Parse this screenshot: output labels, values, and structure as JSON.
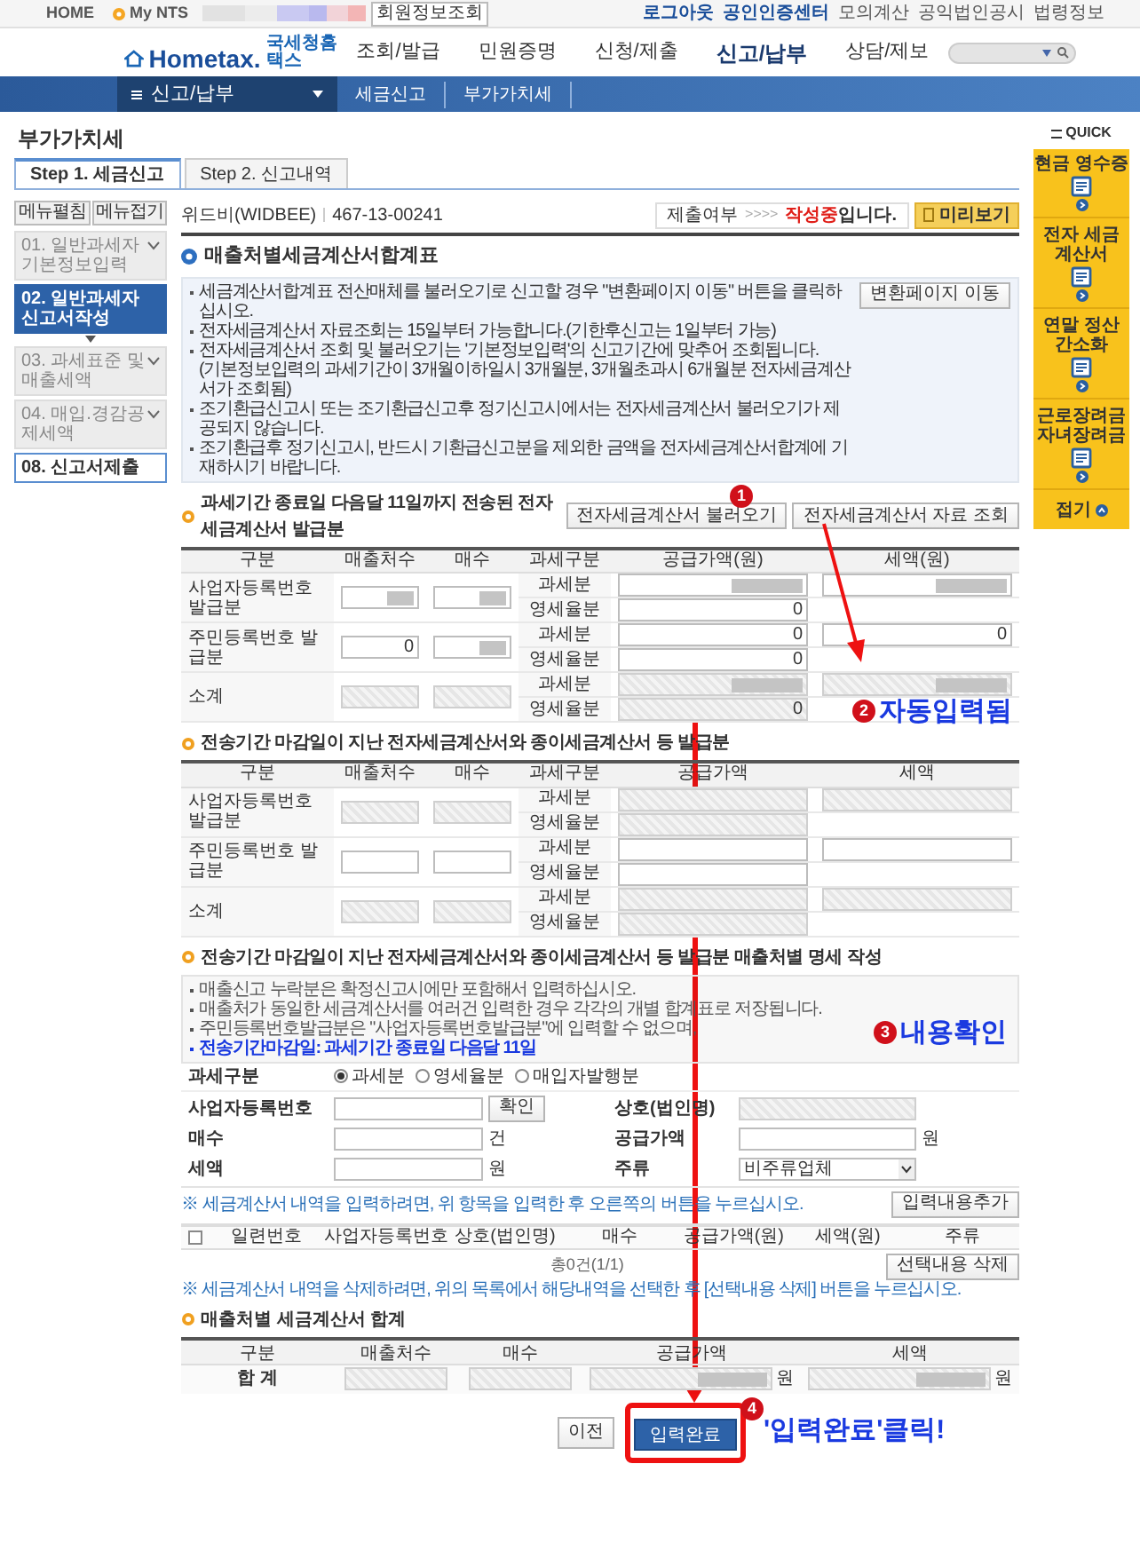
{
  "top_bar": {
    "links_left": [
      "HOME",
      "My NTS"
    ],
    "member_button": "회원정보조회",
    "links_right": [
      "로그아웃",
      "공인인증센터",
      "모의계산",
      "공익법인공시",
      "법령정보"
    ]
  },
  "logo": {
    "name": "Hometax.",
    "korean": "국세청홈택스"
  },
  "main_nav": [
    {
      "label": "조회/발급",
      "selected": false
    },
    {
      "label": "민원증명",
      "selected": false
    },
    {
      "label": "신청/제출",
      "selected": false
    },
    {
      "label": "신고/납부",
      "selected": true
    },
    {
      "label": "상담/제보",
      "selected": false
    }
  ],
  "breadcrumb": {
    "menu": "신고/납부",
    "items": [
      "세금신고",
      "부가가치세"
    ]
  },
  "page_title": "부가가치세",
  "quick": {
    "title": "QUICK",
    "items": [
      "현금 영수증",
      "전자 세금 계산서",
      "연말 정산 간소화",
      "근로장려금 자녀장려금"
    ],
    "fold": "접기"
  },
  "step_tabs": [
    {
      "label": "Step 1. 세금신고",
      "selected": true
    },
    {
      "label": "Step 2. 신고내역",
      "selected": false
    }
  ],
  "side_menu": {
    "buttons": [
      "메뉴펼침",
      "메뉴접기"
    ],
    "items": [
      {
        "label": "01. 일반과세자 기본정보입력",
        "selected": false,
        "expandable": true
      },
      {
        "label": "02. 일반과세자 신고서작성",
        "selected": true,
        "expandable": false
      },
      {
        "label": "03. 과세표준 및 매출세액",
        "selected": false,
        "expandable": true
      },
      {
        "label": "04. 매입.경감공제세액",
        "selected": false,
        "expandable": true
      },
      {
        "label": "08. 신고서제출",
        "selected": false,
        "expandable": false
      }
    ]
  },
  "taxpayer": {
    "name": "위드비(WIDBEE)",
    "biz_no": "467-13-00241"
  },
  "status": {
    "label": "제출여부",
    "arrows": ">>>>",
    "value": "작성중",
    "suffix": "입니다.",
    "preview_button": "미리보기"
  },
  "form_title": "매출처별세금계산서합계표",
  "notice": {
    "button": "변환페이지 이동",
    "lines": [
      {
        "text": "세금계산서합계표 전산매체를 불러오기로 신고할 경우 \"변환페이지 이동\" 버튼을 클릭하십시오.",
        "bullet": true
      },
      {
        "text": "전자세금계산서 자료조회는 15일부터 가능합니다.(기한후신고는 1일부터 가능)",
        "bullet": true
      },
      {
        "text": "전자세금계산서 조회 및 불러오기는 '기본정보입력'의 신고기간에 맞추어 조회됩니다.",
        "bullet": true
      },
      {
        "text": "(기본정보입력의 과세기간이 3개월이하일시 3개월분, 3개월초과시 6개월분 전자세금계산서가 조회됨)",
        "bullet": false
      },
      {
        "text": "조기환급신고시 또는 조기환급신고후 정기신고시에서는 전자세금계산서 불러오기가 제공되지 않습니다.",
        "bullet": true
      },
      {
        "text": "조기환급후 정기신고시, 반드시 기환급신고분을 제외한 금액을 전자세금계산서합계에 기재하시기 바랍니다.",
        "bullet": true
      }
    ]
  },
  "sections": [
    {
      "title": "과세기간 종료일 다음달 11일까지 전송된 전자세금계산서 발급분",
      "buttons": [
        "전자세금계산서 불러오기",
        "전자세금계산서 자료 조회"
      ],
      "columns": [
        "구분",
        "매출처수",
        "매수",
        "과세구분",
        "공급가액(원)",
        "세액(원)"
      ],
      "groups": [
        {
          "label": "사업자등록번호 발급분",
          "count": {
            "disabled": false,
            "masked": true
          },
          "sheets": {
            "disabled": false,
            "masked": true
          },
          "rows": [
            {
              "type": "과세분",
              "supply": {
                "disabled": false,
                "masked": true
              },
              "tax": {
                "disabled": false,
                "masked": true
              }
            },
            {
              "type": "영세율분",
              "supply": {
                "value": "0",
                "disabled": false,
                "masked": false
              }
            }
          ]
        },
        {
          "label": "주민등록번호 발급분",
          "count": {
            "value": "0",
            "disabled": false,
            "masked": false
          },
          "sheets": {
            "disabled": false,
            "masked": true
          },
          "rows": [
            {
              "type": "과세분",
              "supply": {
                "value": "0",
                "disabled": false,
                "masked": false
              },
              "tax": {
                "value": "0",
                "disabled": false,
                "masked": false
              }
            },
            {
              "type": "영세율분",
              "supply": {
                "value": "0",
                "disabled": false,
                "masked": false
              }
            }
          ]
        },
        {
          "label": "소계",
          "count": {
            "disabled": true,
            "masked": false
          },
          "sheets": {
            "disabled": true,
            "masked": false
          },
          "rows": [
            {
              "type": "과세분",
              "supply": {
                "disabled": true,
                "masked": true
              },
              "tax": {
                "disabled": true,
                "masked": true
              }
            },
            {
              "type": "영세율분",
              "supply": {
                "value": "0",
                "disabled": true,
                "masked": false
              }
            }
          ]
        }
      ]
    },
    {
      "title": "전송기간 마감일이 지난 전자세금계산서와 종이세금계산서 등 발급분",
      "columns": [
        "구분",
        "매출처수",
        "매수",
        "과세구분",
        "공급가액",
        "세액"
      ],
      "groups": [
        {
          "label": "사업자등록번호 발급분",
          "count": {
            "disabled": true,
            "masked": false
          },
          "sheets": {
            "disabled": true,
            "masked": false
          },
          "rows": [
            {
              "type": "과세분",
              "supply": {
                "disabled": true,
                "masked": false
              },
              "tax": {
                "disabled": true,
                "masked": false
              }
            },
            {
              "type": "영세율분",
              "supply": {
                "disabled": true,
                "masked": false
              }
            }
          ]
        },
        {
          "label": "주민등록번호 발급분",
          "count": {
            "disabled": false,
            "masked": false
          },
          "sheets": {
            "disabled": false,
            "masked": false
          },
          "rows": [
            {
              "type": "과세분",
              "supply": {
                "disabled": false,
                "masked": false
              },
              "tax": {
                "disabled": false,
                "masked": false
              }
            },
            {
              "type": "영세율분",
              "supply": {
                "disabled": false,
                "masked": false
              }
            }
          ]
        },
        {
          "label": "소계",
          "count": {
            "disabled": true,
            "masked": false
          },
          "sheets": {
            "disabled": true,
            "masked": false
          },
          "rows": [
            {
              "type": "과세분",
              "supply": {
                "disabled": true,
                "masked": false
              },
              "tax": {
                "disabled": true,
                "masked": false
              }
            },
            {
              "type": "영세율분",
              "supply": {
                "disabled": true,
                "masked": false
              }
            }
          ]
        }
      ]
    }
  ],
  "detail": {
    "title": "전송기간 마감일이 지난 전자세금계산서와 종이세금계산서 등 발급분 매출처별 명세 작성",
    "lines": [
      {
        "text": "매출신고 누락분은 확정신고시에만 포함해서 입력하십시오.",
        "emphasis": false
      },
      {
        "text": "매출처가 동일한 세금계산서를 여러건 입력한 경우 각각의 개별 합계표로 저장됩니다.",
        "emphasis": false
      },
      {
        "text": "주민등록번호발급분은 \"사업자등록번호발급분\"에 입력할 수 없으며,",
        "emphasis": false
      },
      {
        "text": "전송기간마감일: 과세기간 종료일 다음달 11일",
        "emphasis": true
      }
    ],
    "tax_type_label": "과세구분",
    "tax_types": [
      {
        "label": "과세분",
        "selected": true
      },
      {
        "label": "영세율분",
        "selected": false
      },
      {
        "label": "매입자발행분",
        "selected": false
      }
    ],
    "biz_no_label": "사업자등록번호",
    "check_button": "확인",
    "company_label": "상호(법인명)",
    "sheets_label": "매수",
    "sheets_unit": "건",
    "supply_label": "공급가액",
    "supply_unit": "원",
    "tax_label": "세액",
    "tax_unit": "원",
    "liquor_label": "주류",
    "liquor_value": "비주류업체",
    "add_note": "※ 세금계산서 내역을 입력하려면, 위 항목을 입력한 후 오른쪽의 버튼을 누르십시오.",
    "add_button": "입력내용추가",
    "list_columns": [
      "일련번호",
      "사업자등록번호",
      "상호(법인명)",
      "매수",
      "공급가액(원)",
      "세액(원)",
      "주류"
    ],
    "list_checked": false,
    "pagination": "총0건(1/1)",
    "delete_note": "※ 세금계산서 내역을 삭제하려면, 위의 목록에서 해당내역을 선택한 후 [선택내용 삭제] 버튼을 누르십시오.",
    "delete_button": "선택내용 삭제"
  },
  "total": {
    "title": "매출처별 세금계산서 합계",
    "columns": [
      "구분",
      "매출처수",
      "매수",
      "공급가액",
      "세액"
    ],
    "label": "합 계",
    "unit_supply": "원",
    "unit_tax": "원"
  },
  "buttons": {
    "prev": "이전",
    "done": "입력완료"
  },
  "annotations": {
    "step1": "1",
    "step2": "2",
    "auto": "자동입력됨",
    "step3": "3",
    "check": "내용확인",
    "step4": "4",
    "click": "'입력완료'클릭!"
  }
}
